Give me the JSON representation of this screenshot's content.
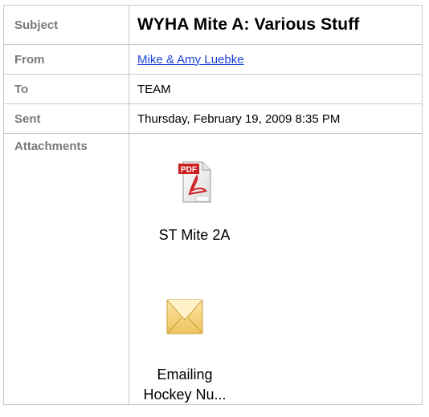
{
  "header": {
    "subject_label": "Subject",
    "subject_value": "WYHA Mite A:  Various Stuff",
    "from_label": "From",
    "from_value": "Mike & Amy Luebke",
    "to_label": "To",
    "to_value": "TEAM",
    "sent_label": "Sent",
    "sent_value": "Thursday, February 19, 2009 8:35 PM",
    "attachments_label": "Attachments"
  },
  "attachments": [
    {
      "name": "ST Mite 2A",
      "icon": "pdf-file-icon",
      "badge": "PDF"
    },
    {
      "name_line1": "Emailing",
      "name_line2": "Hockey Nu...",
      "icon": "email-envelope-icon"
    }
  ],
  "colors": {
    "label": "#7a7a7a",
    "link": "#1a40d8",
    "border": "#c8c8c8",
    "pdf_red": "#cc1f1f",
    "envelope": "#f2cf6e"
  }
}
